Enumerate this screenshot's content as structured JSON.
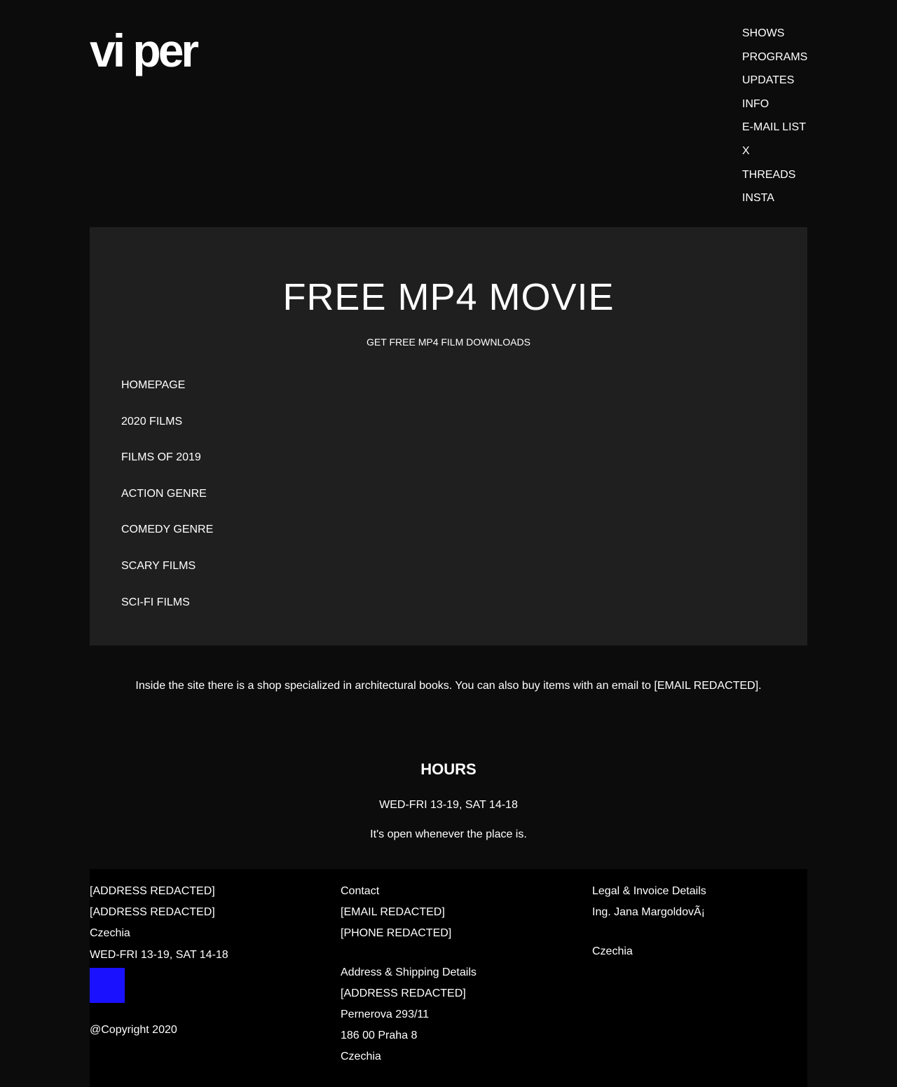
{
  "colors": {
    "page_background": "#0c0c0c",
    "hero_background": "#1f1f1f",
    "footer_background": "#000000",
    "text": "#ffffff",
    "swatch": "#1a12ff"
  },
  "header": {
    "logo": "vi per",
    "nav": [
      "SHOWS",
      "PROGRAMS",
      "UPDATES",
      "INFO",
      "E-MAIL LIST",
      "X",
      "THREADS",
      "INSTA"
    ]
  },
  "hero": {
    "title": "FREE MP4 MOVIE",
    "subtitle": "GET FREE MP4 FILM DOWNLOADS",
    "menu": [
      "HOMEPAGE",
      "2020 FILMS",
      "FILMS OF 2019",
      "ACTION GENRE",
      "COMEDY GENRE",
      "SCARY FILMS",
      "SCI-FI FILMS"
    ]
  },
  "intro": "Inside the site there is a shop specialized in architectural books. You can also buy items with an email to [EMAIL REDACTED].",
  "hours": {
    "title": "HOURS",
    "times": "WED-FRI 13-19, SAT 14-18",
    "note": "It's open whenever the place is."
  },
  "footer": {
    "col1": {
      "lines": [
        "[ADDRESS REDACTED]",
        "[ADDRESS REDACTED]",
        "Czechia",
        "WED-FRI 13-19, SAT 14-18"
      ],
      "copyright": "@Copyright 2020"
    },
    "col2": {
      "contact_heading": "Contact",
      "contact_lines": [
        "[EMAIL REDACTED]",
        "[PHONE REDACTED]"
      ],
      "shipping_heading": "Address & Shipping Details",
      "shipping_lines": [
        "[ADDRESS REDACTED]",
        "Pernerova 293/11",
        "186 00 Praha 8",
        "Czechia"
      ]
    },
    "col3": {
      "heading": "Legal & Invoice Details",
      "name": "Ing. Jana MargoldovÃ¡",
      "country": "Czechia"
    }
  }
}
